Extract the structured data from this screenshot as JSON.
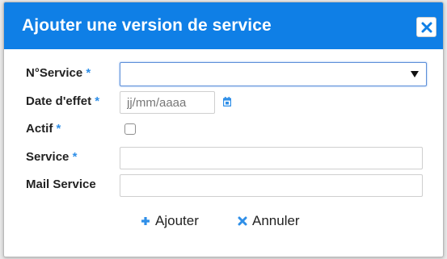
{
  "dialog": {
    "title": "Ajouter une version de service",
    "close_icon": "close-icon"
  },
  "form": {
    "required_marker": "*",
    "n_service": {
      "label": "N°Service",
      "value": ""
    },
    "date_effet": {
      "label": "Date d'effet",
      "placeholder": "jj/mm/aaaa",
      "icon": "calendar-icon"
    },
    "actif": {
      "label": "Actif",
      "checked": false
    },
    "service": {
      "label": "Service",
      "value": ""
    },
    "mail_service": {
      "label": "Mail Service",
      "value": ""
    }
  },
  "actions": {
    "add": {
      "label": "Ajouter",
      "icon": "plus-icon"
    },
    "cancel": {
      "label": "Annuler",
      "icon": "x-icon"
    }
  },
  "colors": {
    "header": "#0f7fe6",
    "accent": "#2f8fe8",
    "text": "#222222"
  }
}
